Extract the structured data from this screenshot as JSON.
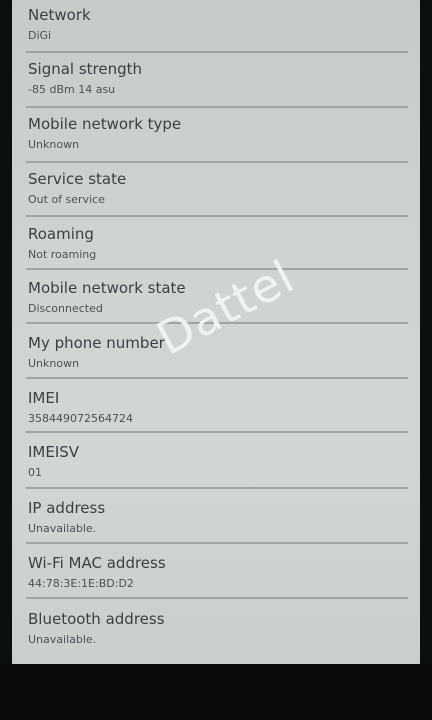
{
  "watermark": "Dattel",
  "items": [
    {
      "title": "Network",
      "summary": "DiGi"
    },
    {
      "title": "Signal strength",
      "summary": "-85 dBm   14 asu"
    },
    {
      "title": "Mobile network type",
      "summary": "Unknown"
    },
    {
      "title": "Service state",
      "summary": "Out of service"
    },
    {
      "title": "Roaming",
      "summary": "Not roaming"
    },
    {
      "title": "Mobile network state",
      "summary": "Disconnected"
    },
    {
      "title": "My phone number",
      "summary": "Unknown"
    },
    {
      "title": "IMEI",
      "summary": "358449072564724"
    },
    {
      "title": "IMEISV",
      "summary": "01"
    },
    {
      "title": "IP address",
      "summary": "Unavailable."
    },
    {
      "title": "Wi-Fi MAC address",
      "summary": "44:78:3E:1E:BD:D2"
    },
    {
      "title": "Bluetooth address",
      "summary": "Unavailable."
    }
  ]
}
